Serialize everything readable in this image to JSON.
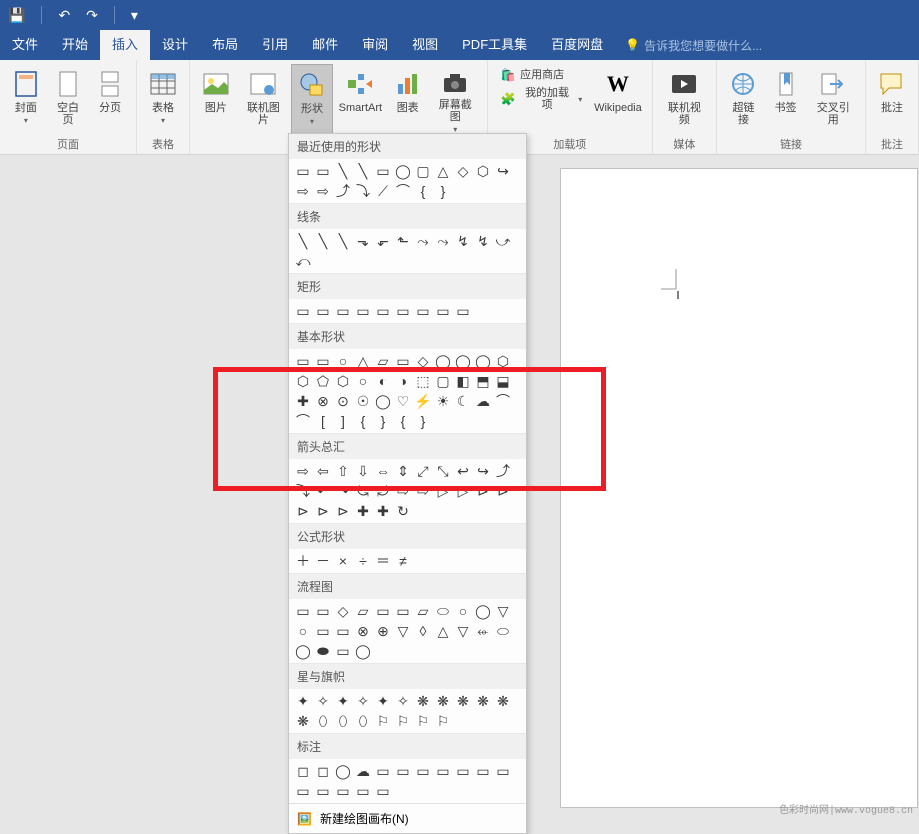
{
  "qat": {
    "save": "💾",
    "undo": "↶",
    "redo": "↷",
    "customize": "▾"
  },
  "tabs": {
    "file": "文件",
    "home": "开始",
    "insert": "插入",
    "design": "设计",
    "layout": "布局",
    "references": "引用",
    "mailings": "邮件",
    "review": "审阅",
    "view": "视图",
    "pdf": "PDF工具集",
    "baidu": "百度网盘"
  },
  "tellme": {
    "placeholder": "告诉我您想要做什么..."
  },
  "ribbon": {
    "groups": {
      "pages": {
        "label": "页面",
        "cover": "封面",
        "blank": "空白页",
        "break": "分页"
      },
      "tables": {
        "label": "表格",
        "table": "表格"
      },
      "illustrations": {
        "pictures": "图片",
        "online_pictures": "联机图片",
        "shapes": "形状",
        "smartart": "SmartArt",
        "chart": "图表",
        "screenshot": "屏幕截图"
      },
      "addins": {
        "label": "加载项",
        "store": "应用商店",
        "myaddins": "我的加载项"
      },
      "wikipedia": {
        "label": "Wikipedia"
      },
      "media": {
        "label": "媒体",
        "video": "联机视频"
      },
      "links": {
        "label": "链接",
        "hyperlink": "超链接",
        "bookmark": "书签",
        "crossref": "交叉引用"
      },
      "comments": {
        "label": "批注",
        "comment": "批注"
      }
    }
  },
  "shapes_dropdown": {
    "cat_recent": "最近使用的形状",
    "cat_lines": "线条",
    "cat_rects": "矩形",
    "cat_basic": "基本形状",
    "cat_arrows": "箭头总汇",
    "cat_equation": "公式形状",
    "cat_flowchart": "流程图",
    "cat_stars": "星与旗帜",
    "cat_callouts": "标注",
    "new_canvas": "新建绘图画布(N)"
  },
  "watermark": "色彩时尚网|www.vogue8.cn"
}
